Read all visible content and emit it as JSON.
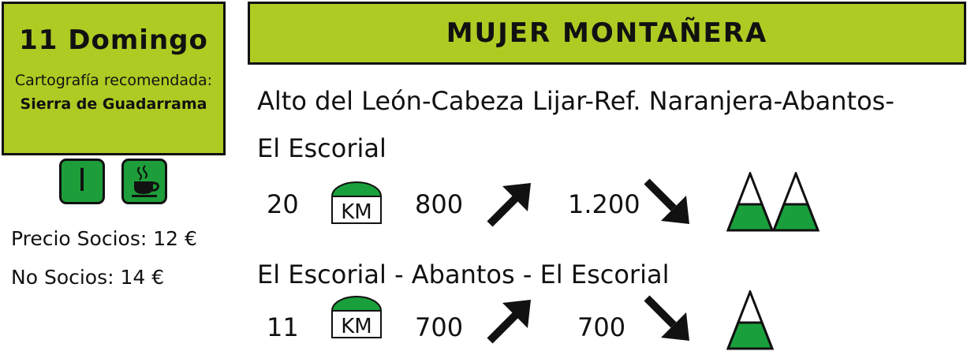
{
  "date_box": {
    "date": "11 Domingo",
    "cartography_label": "Cartografía recomendada:",
    "cartography_name": "Sierra de Guadarrama"
  },
  "badges": {
    "level": "I",
    "coffee_icon": "coffee-cup-icon"
  },
  "prices": {
    "members": "Precio Socios: 12 €",
    "non_members": "No Socios: 14 €"
  },
  "title": "MUJER MONTAÑERA",
  "routes": [
    {
      "name_line1": "Alto del León-Cabeza Lijar-Ref. Naranjera-Abantos-",
      "name_line2": "El Escorial",
      "km": "20",
      "km_icon": "KM",
      "ascent": "800",
      "descent": "1.200",
      "difficulty_icons": 2
    },
    {
      "name_line1": "El Escorial - Abantos - El Escorial",
      "km": "11",
      "km_icon": "KM",
      "ascent": "700",
      "descent": "700",
      "difficulty_icons": 1
    }
  ],
  "colors": {
    "header_green": "#aecb23",
    "badge_green": "#1e9e3a",
    "icon_green": "#19a03c",
    "dark": "#111111"
  }
}
